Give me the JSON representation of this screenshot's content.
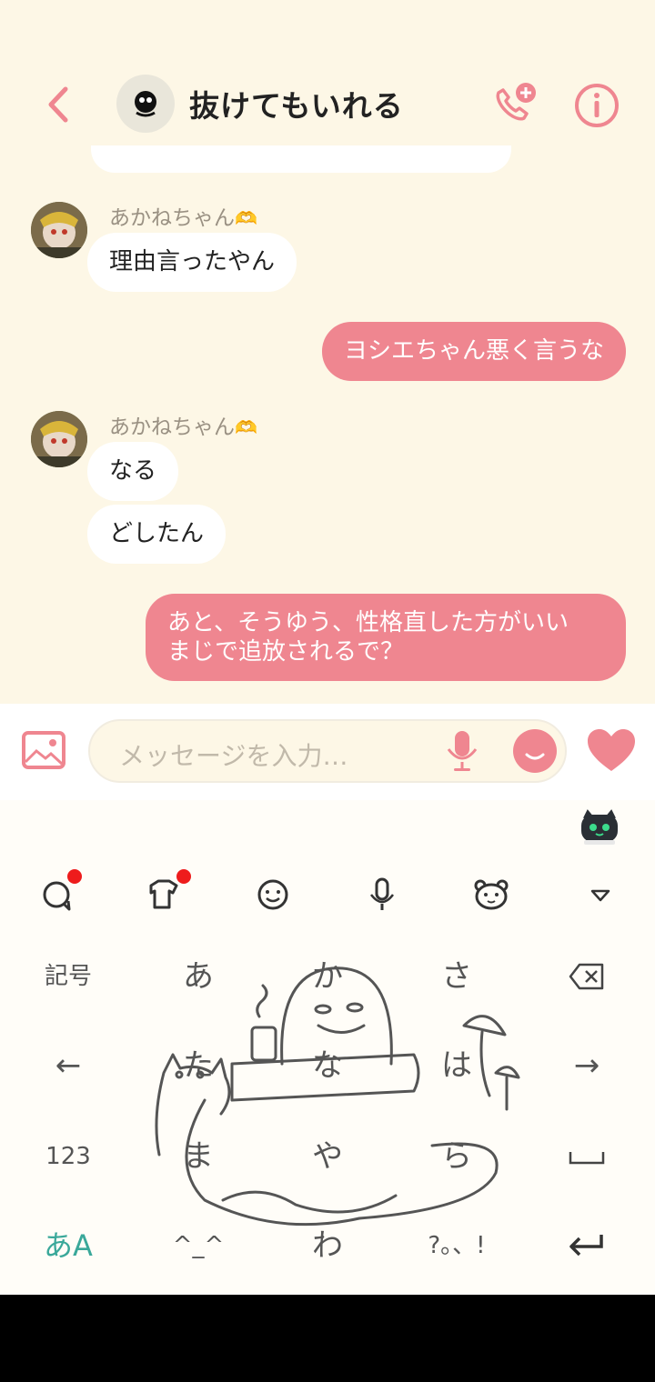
{
  "header": {
    "title": "抜けてもいれる"
  },
  "messages": [
    {
      "sender": "あかねちゃん",
      "texts": [
        "理由言ったやん"
      ]
    },
    {
      "out": "ヨシエちゃん悪く言うな"
    },
    {
      "sender": "あかねちゃん",
      "texts": [
        "なる",
        "どしたん"
      ]
    },
    {
      "out_lines": [
        "あと、そうゆう、性格直した方がいい",
        "まじで追放されるで？"
      ]
    }
  ],
  "input": {
    "placeholder": "メッセージを入力…"
  },
  "keyboard": {
    "toolbar": [
      "speech-bubble-icon",
      "shirt-icon",
      "smiley-icon",
      "mic-icon",
      "bear-icon",
      "collapse-icon"
    ],
    "rows": [
      [
        "記号",
        "あ",
        "か",
        "さ",
        "⌫"
      ],
      [
        "←",
        "た",
        "な",
        "は",
        "→"
      ],
      [
        "123",
        "ま",
        "や",
        "ら",
        "␣"
      ],
      [
        "あA",
        "^_^",
        "わ",
        "?。、!",
        "↵"
      ]
    ]
  },
  "colors": {
    "accent": "#ef8690",
    "background": "#fdf7e6"
  }
}
